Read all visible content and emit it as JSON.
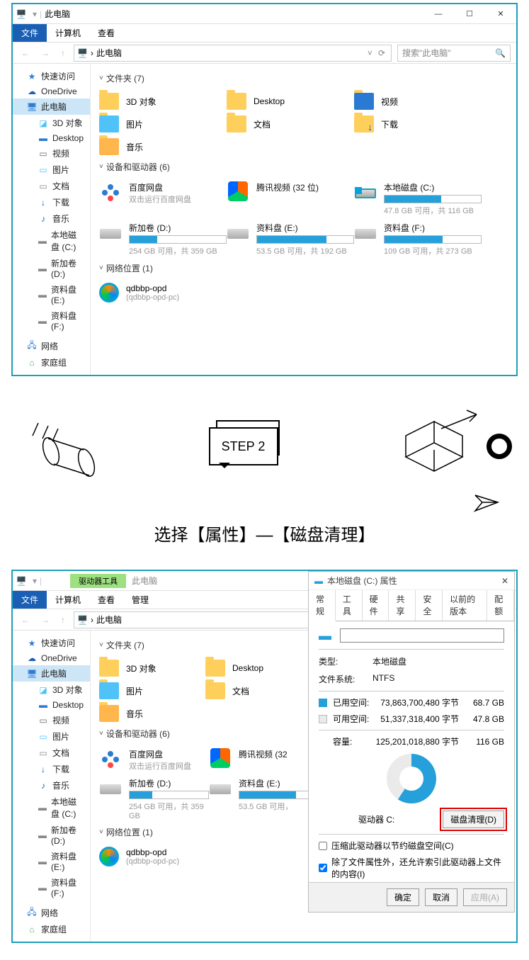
{
  "step": {
    "label": "STEP 2",
    "caption": "选择【属性】—【磁盘清理】"
  },
  "explorer": {
    "title": "此电脑",
    "ribbon": {
      "file": "文件",
      "computer": "计算机",
      "view": "查看",
      "drivetools": "驱动器工具",
      "manage": "管理"
    },
    "breadcrumb": "此电脑",
    "search_placeholder": "搜索\"此电脑\"",
    "nav": {
      "quick": "快速访问",
      "onedrive": "OneDrive",
      "pc": "此电脑",
      "subs": [
        "3D 对象",
        "Desktop",
        "视频",
        "图片",
        "文档",
        "下载",
        "音乐",
        "本地磁盘 (C:)",
        "新加卷 (D:)",
        "资料盘 (E:)",
        "资料盘 (F:)"
      ],
      "network": "网络",
      "homegroup": "家庭组"
    },
    "groups": {
      "folders_hdr": "文件夹 (7)",
      "folders": [
        "3D 对象",
        "Desktop",
        "视频",
        "图片",
        "文档",
        "下载",
        "音乐"
      ],
      "drives_hdr": "设备和驱动器 (6)",
      "drives": [
        {
          "name": "百度网盘",
          "sub": "双击运行百度网盘",
          "bar": null
        },
        {
          "name": "腾讯视频 (32 位)",
          "sub": "",
          "bar": null
        },
        {
          "name": "本地磁盘 (C:)",
          "sub": "47.8 GB 可用，共 116 GB",
          "bar": 59
        },
        {
          "name": "新加卷 (D:)",
          "sub": "254 GB 可用，共 359 GB",
          "bar": 29
        },
        {
          "name": "资料盘 (E:)",
          "sub": "53.5 GB 可用，共 192 GB",
          "bar": 72
        },
        {
          "name": "资料盘 (F:)",
          "sub": "109 GB 可用，共 273 GB",
          "bar": 60
        }
      ],
      "netloc_hdr": "网络位置 (1)",
      "netloc": {
        "l1": "qdbbp-opd",
        "l2": "(qdbbp-opd-pc)"
      }
    }
  },
  "properties": {
    "title": "本地磁盘 (C:) 属性",
    "tabs": [
      "常规",
      "工具",
      "硬件",
      "共享",
      "安全",
      "以前的版本",
      "配额"
    ],
    "type_k": "类型:",
    "type_v": "本地磁盘",
    "fs_k": "文件系统:",
    "fs_v": "NTFS",
    "used_k": "已用空间:",
    "used_bytes": "73,863,700,480 字节",
    "used_gb": "68.7 GB",
    "free_k": "可用空间:",
    "free_bytes": "51,337,318,400 字节",
    "free_gb": "47.8 GB",
    "cap_k": "容量:",
    "cap_bytes": "125,201,018,880 字节",
    "cap_gb": "116 GB",
    "drive_label": "驱动器 C:",
    "cleanup": "磁盘清理(D)",
    "cb1": "压缩此驱动器以节约磁盘空间(C)",
    "cb2": "除了文件属性外，还允许索引此驱动器上文件的内容(I)",
    "ok": "确定",
    "cancel": "取消",
    "apply": "应用(A)"
  }
}
